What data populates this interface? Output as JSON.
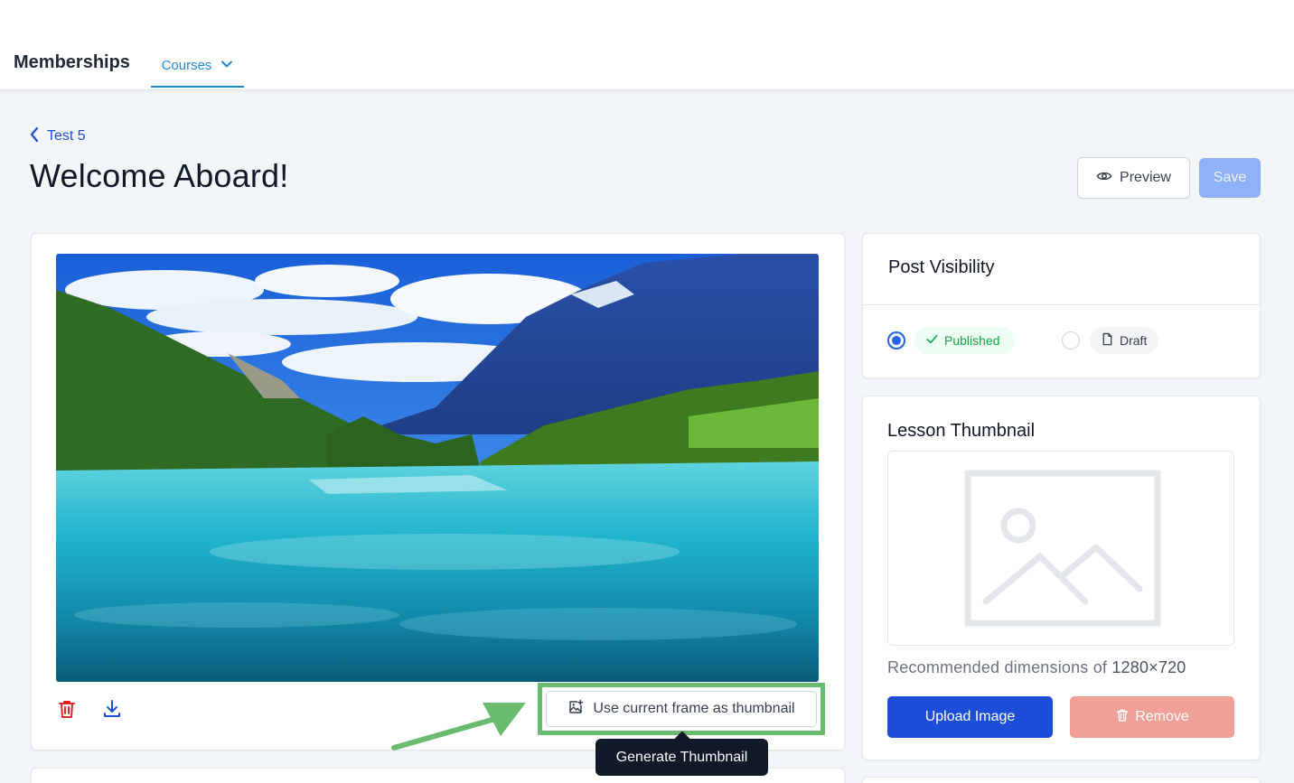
{
  "nav": {
    "brand": "Memberships",
    "tab_courses": "Courses"
  },
  "header": {
    "back_label": "Test 5",
    "title": "Welcome Aboard!",
    "preview_label": "Preview",
    "save_label": "Save"
  },
  "video": {
    "use_frame_label": "Use current frame as thumbnail",
    "tooltip": "Generate Thumbnail"
  },
  "visibility": {
    "title": "Post Visibility",
    "published_label": "Published",
    "draft_label": "Draft",
    "selected": "Published"
  },
  "thumbnail": {
    "title": "Lesson Thumbnail",
    "dims_prefix": "Recommended dimensions of ",
    "dims_value": "1280×720",
    "upload_label": "Upload Image",
    "remove_label": "Remove"
  },
  "colors": {
    "accent": "#1d4ed8",
    "nav_active": "#1e88d6",
    "highlight": "#6abb6f",
    "published": "#16a34a",
    "danger": "#dc2626",
    "remove_bg": "#f0a097",
    "save_bg": "#8fb1f7"
  },
  "icons": [
    "chevron-down-icon",
    "chevron-left-icon",
    "eye-icon",
    "trash-icon",
    "download-icon",
    "image-plus-icon",
    "check-icon",
    "file-icon",
    "image-placeholder-icon"
  ]
}
